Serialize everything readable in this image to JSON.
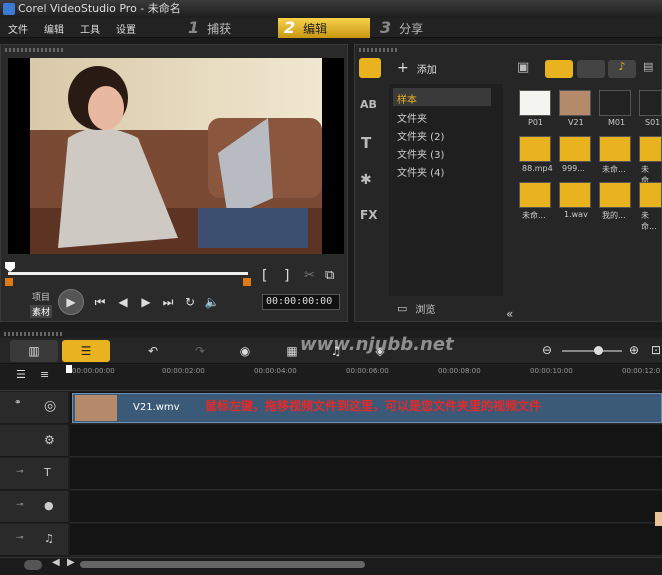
{
  "window": {
    "title": "Corel VideoStudio Pro - 未命名"
  },
  "menu": [
    "文件",
    "编辑",
    "工具",
    "设置"
  ],
  "steps": [
    {
      "num": "1",
      "label": "捕获"
    },
    {
      "num": "2",
      "label": "编辑"
    },
    {
      "num": "3",
      "label": "分享"
    }
  ],
  "preview": {
    "mode_project": "项目",
    "mode_clip": "素材",
    "timecode": "00:00:00:00",
    "bracket_in": "[",
    "bracket_out": "]"
  },
  "library": {
    "add_label": "添加",
    "browse_label": "浏览",
    "folders": [
      "样本",
      "文件夹",
      "文件夹 (2)",
      "文件夹 (3)",
      "文件夹 (4)"
    ],
    "thumbnails": [
      {
        "label": "P01"
      },
      {
        "label": "V21"
      },
      {
        "label": "M01"
      },
      {
        "label": "S01"
      },
      {
        "label": "88.mp4"
      },
      {
        "label": "999..."
      },
      {
        "label": "未命..."
      },
      {
        "label": "未命..."
      },
      {
        "label": "未命..."
      },
      {
        "label": "1.wav"
      },
      {
        "label": "我的..."
      },
      {
        "label": "未命..."
      }
    ]
  },
  "timeline": {
    "ruler": [
      "00:00:00:00",
      "00:00:02:00",
      "00:00:04:00",
      "00:00:06:00",
      "00:00:08:00",
      "00:00:10:00",
      "00:00:12:0"
    ],
    "clip_name": "V21.wmv",
    "annotation": "鼠标左键，拖移视频文件到这里，可以是您文件夹里的视频文件",
    "watermark": "www.njubb.net"
  },
  "colors": {
    "accent": "#e9b21f",
    "annotation": "#e32a2a"
  }
}
